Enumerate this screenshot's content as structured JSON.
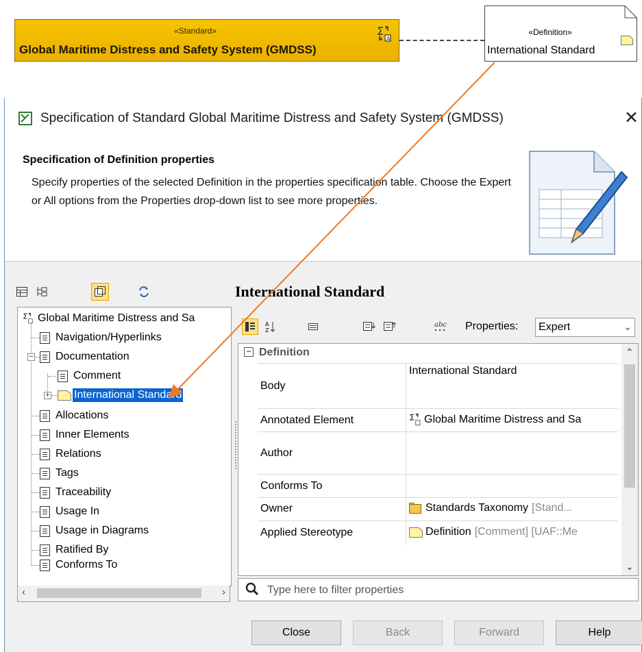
{
  "diagram": {
    "standard_block": {
      "stereotype": "«Standard»",
      "name": "Global Maritime Distress and Safety System (GMDSS)"
    },
    "definition_note": {
      "stereotype": "«Definition»",
      "name": "International Standard"
    }
  },
  "dialog": {
    "title": "Specification of Standard Global Maritime Distress and Safety System (GMDSS)",
    "close_glyph": "✕",
    "header": {
      "title": "Specification of Definition properties",
      "description": "Specify properties of the selected Definition in the properties specification table. Choose the Expert or All options from the Properties drop-down list to see more properties."
    },
    "tree": {
      "root": "Global Maritime Distress and Sa",
      "items": [
        "Navigation/Hyperlinks",
        "Documentation",
        "Comment",
        "International Standard",
        "Allocations",
        "Inner Elements",
        "Relations",
        "Tags",
        "Traceability",
        "Usage In",
        "Usage in Diagrams",
        "Ratified By",
        "Conforms To"
      ],
      "selected": "International Standard"
    },
    "properties": {
      "element_title": "International Standard",
      "mode_label": "Properties:",
      "mode_value": "Expert",
      "group": "Definition",
      "rows": [
        {
          "name": "Body",
          "value": "International Standard",
          "extra": ""
        },
        {
          "name": "Annotated Element",
          "value": "Global Maritime Distress and Sa",
          "extra": ""
        },
        {
          "name": "Author",
          "value": "",
          "extra": ""
        },
        {
          "name": "Conforms To",
          "value": "",
          "extra": ""
        },
        {
          "name": "Owner",
          "value": "Standards Taxonomy",
          "extra": "[Stand..."
        },
        {
          "name": "Applied Stereotype",
          "value": "Definition",
          "extra": "[Comment] [UAF::Me"
        }
      ]
    },
    "filter_placeholder": "Type here to filter properties",
    "buttons": {
      "close": "Close",
      "back": "Back",
      "forward": "Forward",
      "help": "Help"
    }
  },
  "colors": {
    "standard_fill": "#f2bd00",
    "selection": "#0a64d2",
    "arrow": "#f07820",
    "toolbar_active": "#ffe08a"
  }
}
